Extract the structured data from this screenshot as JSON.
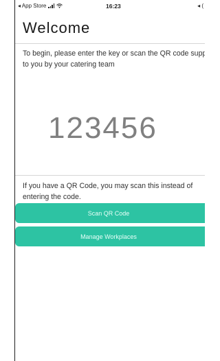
{
  "status_bar": {
    "back_label": "◂ App Store",
    "time": "16:23",
    "right_glyph": "◂ ("
  },
  "page": {
    "title": "Welcome",
    "intro_text": "To begin, please enter the key or scan the QR code supplied to you by your catering team",
    "code_value": "123456",
    "qr_note": "If you have a QR Code, you may scan this instead of entering the code."
  },
  "buttons": {
    "scan_qr": "Scan QR Code",
    "manage_workplaces": "Manage Workplaces"
  },
  "colors": {
    "accent": "#2dc3a3",
    "code_text": "#808080"
  }
}
